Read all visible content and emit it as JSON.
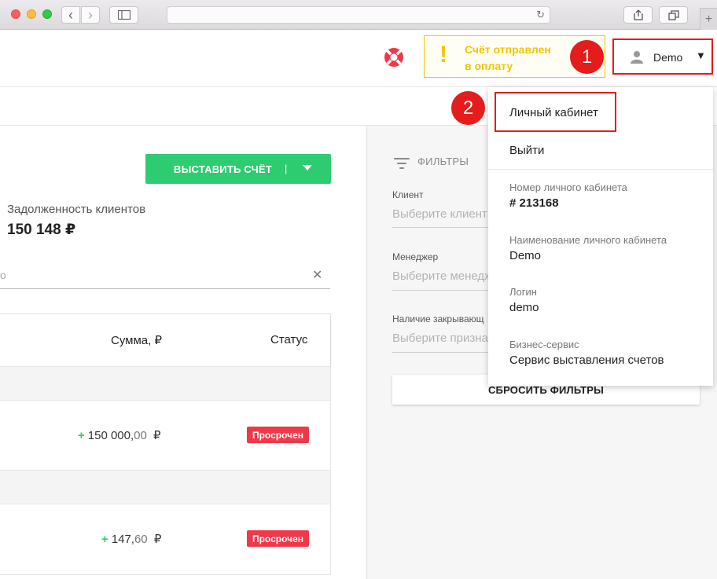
{
  "browser": {
    "back_glyph": "‹",
    "forward_glyph": "›",
    "reload_glyph": "↻",
    "new_tab_glyph": "+"
  },
  "header": {
    "notice_text": "Счёт отправлен\nв оплату",
    "notice_mark": "!",
    "user_name": "Demo",
    "user_caret": "▼",
    "callouts": [
      "1",
      "2"
    ],
    "colors": {
      "notice": "#f5c400",
      "callout": "#e41c1c",
      "help": "#f0384a"
    }
  },
  "main": {
    "invoice_button": "ВЫСТАВИТЬ СЧЁТ",
    "invoice_separator": "|",
    "debt_label": "Задолженность клиентов",
    "debt_value": "150 148 ₽",
    "search_stub": "о",
    "search_clear": "✕",
    "table": {
      "col_sum": "Сумма, ₽",
      "col_status": "Статус",
      "rows": [
        {
          "plus": "+",
          "amount": "150 000,",
          "cents": "00",
          "currency": "₽",
          "status": "Просрочен"
        },
        {
          "plus": "+",
          "amount": "147,",
          "cents": "60",
          "currency": "₽",
          "status": "Просрочен"
        }
      ]
    }
  },
  "filters": {
    "title": "ФИЛЬТРЫ",
    "client_label": "Клиент",
    "client_placeholder": "Выберите клиент",
    "manager_label": "Менеджер",
    "manager_placeholder": "Выберите менедж",
    "closing_label": "Наличие закрывающ",
    "closing_placeholder": "Выберите призна",
    "reset_button": "СБРОСИТЬ ФИЛЬТРЫ"
  },
  "dropdown": {
    "cabinet_link": "Личный кабинет",
    "logout_link": "Выйти",
    "account_number_label": "Номер личного кабинета",
    "account_number_value": "# 213168",
    "account_name_label": "Наименование личного кабинета",
    "account_name_value": "Demo",
    "login_label": "Логин",
    "login_value": "demo",
    "service_label": "Бизнес-сервис",
    "service_value": "Сервис выставления счетов"
  }
}
